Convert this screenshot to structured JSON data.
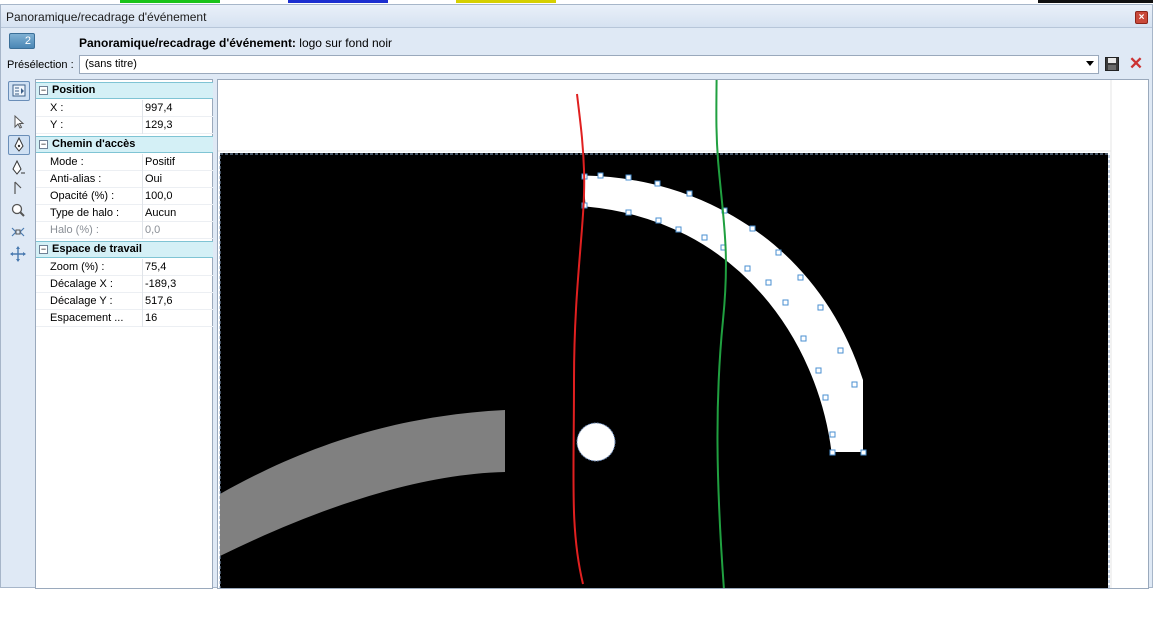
{
  "window": {
    "title": "Panoramique/recadrage d'événement",
    "event_number": "2",
    "event_label_bold": "Panoramique/recadrage d'événement:",
    "event_label_value": "logo sur fond noir"
  },
  "preset": {
    "label": "Présélection :",
    "value": "(sans titre)"
  },
  "toolstrip": {
    "tools": [
      {
        "icon": "properties-icon",
        "active": true
      },
      {
        "icon": "pointer-icon",
        "active": false
      },
      {
        "icon": "pen-icon",
        "active": true
      },
      {
        "icon": "add-point-pen-icon",
        "active": false
      },
      {
        "icon": "edit-point-icon",
        "active": false
      },
      {
        "icon": "zoom-icon",
        "active": false
      },
      {
        "icon": "scale-icon",
        "active": false
      },
      {
        "icon": "move-icon",
        "active": false
      }
    ]
  },
  "properties": {
    "position": {
      "title": "Position",
      "rows": [
        {
          "label": "X :",
          "value": "997,4"
        },
        {
          "label": "Y :",
          "value": "129,3"
        }
      ]
    },
    "path": {
      "title": "Chemin  d'accès",
      "rows": [
        {
          "label": "Mode :",
          "value": "Positif"
        },
        {
          "label": "Anti-alias :",
          "value": "Oui"
        },
        {
          "label": "Opacité (%) :",
          "value": "100,0"
        },
        {
          "label": "Type de halo :",
          "value": "Aucun"
        },
        {
          "label": "Halo (%) :",
          "value": "0,0"
        }
      ]
    },
    "workspace": {
      "title": "Espace de travail",
      "rows": [
        {
          "label": "Zoom (%) :",
          "value": "75,4"
        },
        {
          "label": "Décalage X :",
          "value": "-189,3"
        },
        {
          "label": "Décalage Y :",
          "value": "517,6"
        },
        {
          "label": "Espacement ...",
          "value": "16"
        }
      ]
    }
  },
  "colors": {
    "title_bg": "#dfe9f5",
    "category_bg": "#d4f0f6",
    "canvas_bg": "#000000",
    "handle": "#4a8fd0",
    "red_line": "#e02020",
    "green_line": "#20a040"
  }
}
